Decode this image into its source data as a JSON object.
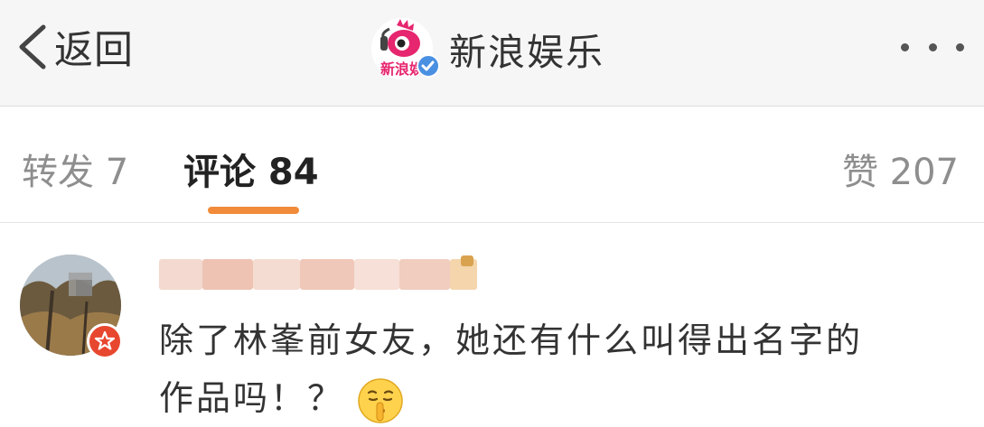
{
  "header": {
    "back_label": "返回",
    "title": "新浪娱乐",
    "logo_text": "新浪娱",
    "more_icon": "more-icon"
  },
  "tabs": [
    {
      "label": "转发 7",
      "active": false
    },
    {
      "label": "评论 84",
      "active": true
    },
    {
      "label": "赞 207",
      "active": false
    }
  ],
  "comment": {
    "username_blurred": true,
    "line1": "除了林峯前女友，她还有什么叫得出名字的",
    "line2": "作品吗！？",
    "emoji": "shush-emoji"
  },
  "colors": {
    "accent": "#f18b3a",
    "verified": "#4a90e2",
    "badge": "#e8472f",
    "logo": "#e6266f"
  }
}
